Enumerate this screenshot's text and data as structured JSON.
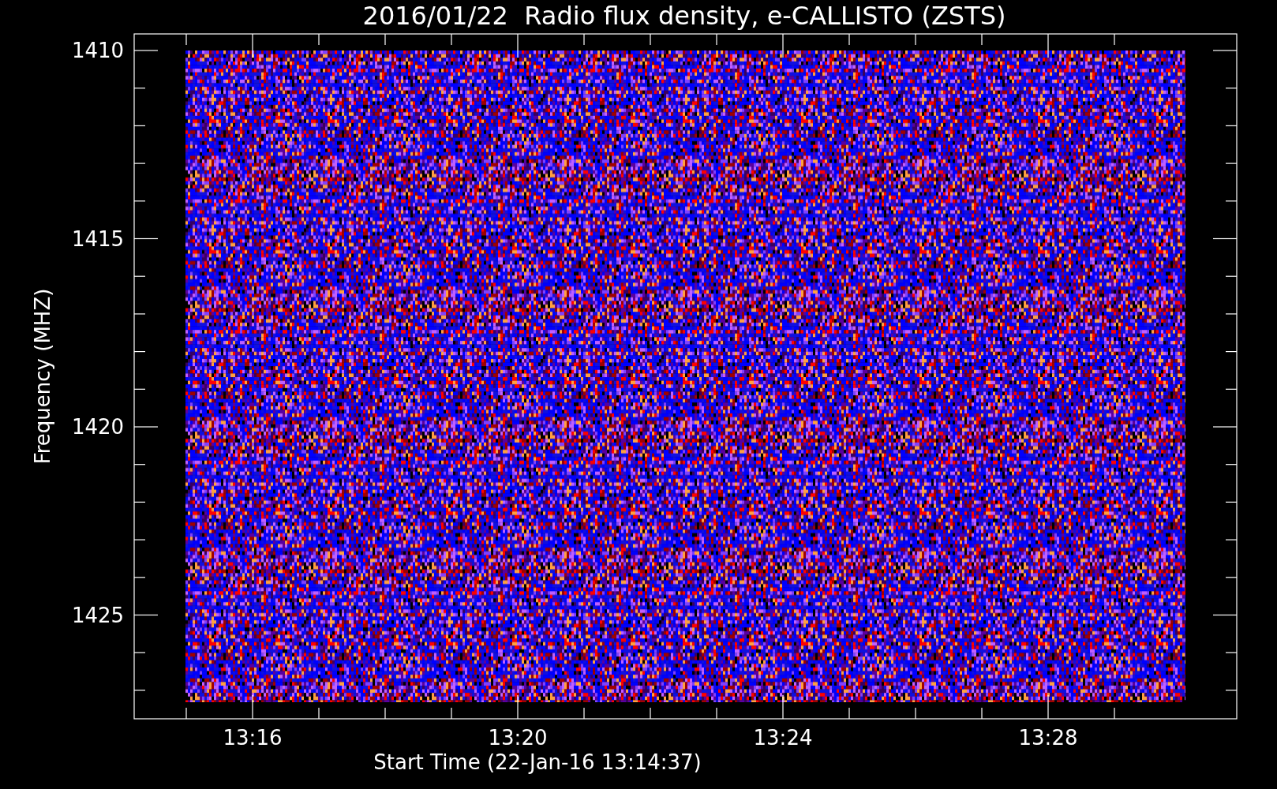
{
  "title": "2016/01/22  Radio flux density, e-CALLISTO (ZSTS)",
  "y_axis": {
    "label": "Frequency (MHZ)",
    "ticks": [
      "1410",
      "1415",
      "1420",
      "1425"
    ]
  },
  "x_axis": {
    "label": "Start Time (22-Jan-16 13:14:37)",
    "ticks": [
      "13:16",
      "13:20",
      "13:24",
      "13:28"
    ]
  }
}
